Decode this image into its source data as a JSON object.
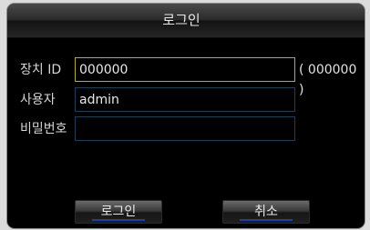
{
  "dialog": {
    "title": "로그인",
    "device_id": {
      "label": "장치 ID",
      "value": "000000",
      "hint": "( 000000 )"
    },
    "user": {
      "label": "사용자",
      "value": "admin"
    },
    "password": {
      "label": "비밀번호",
      "value": ""
    },
    "buttons": {
      "login": "로그인",
      "cancel": "취소"
    }
  }
}
